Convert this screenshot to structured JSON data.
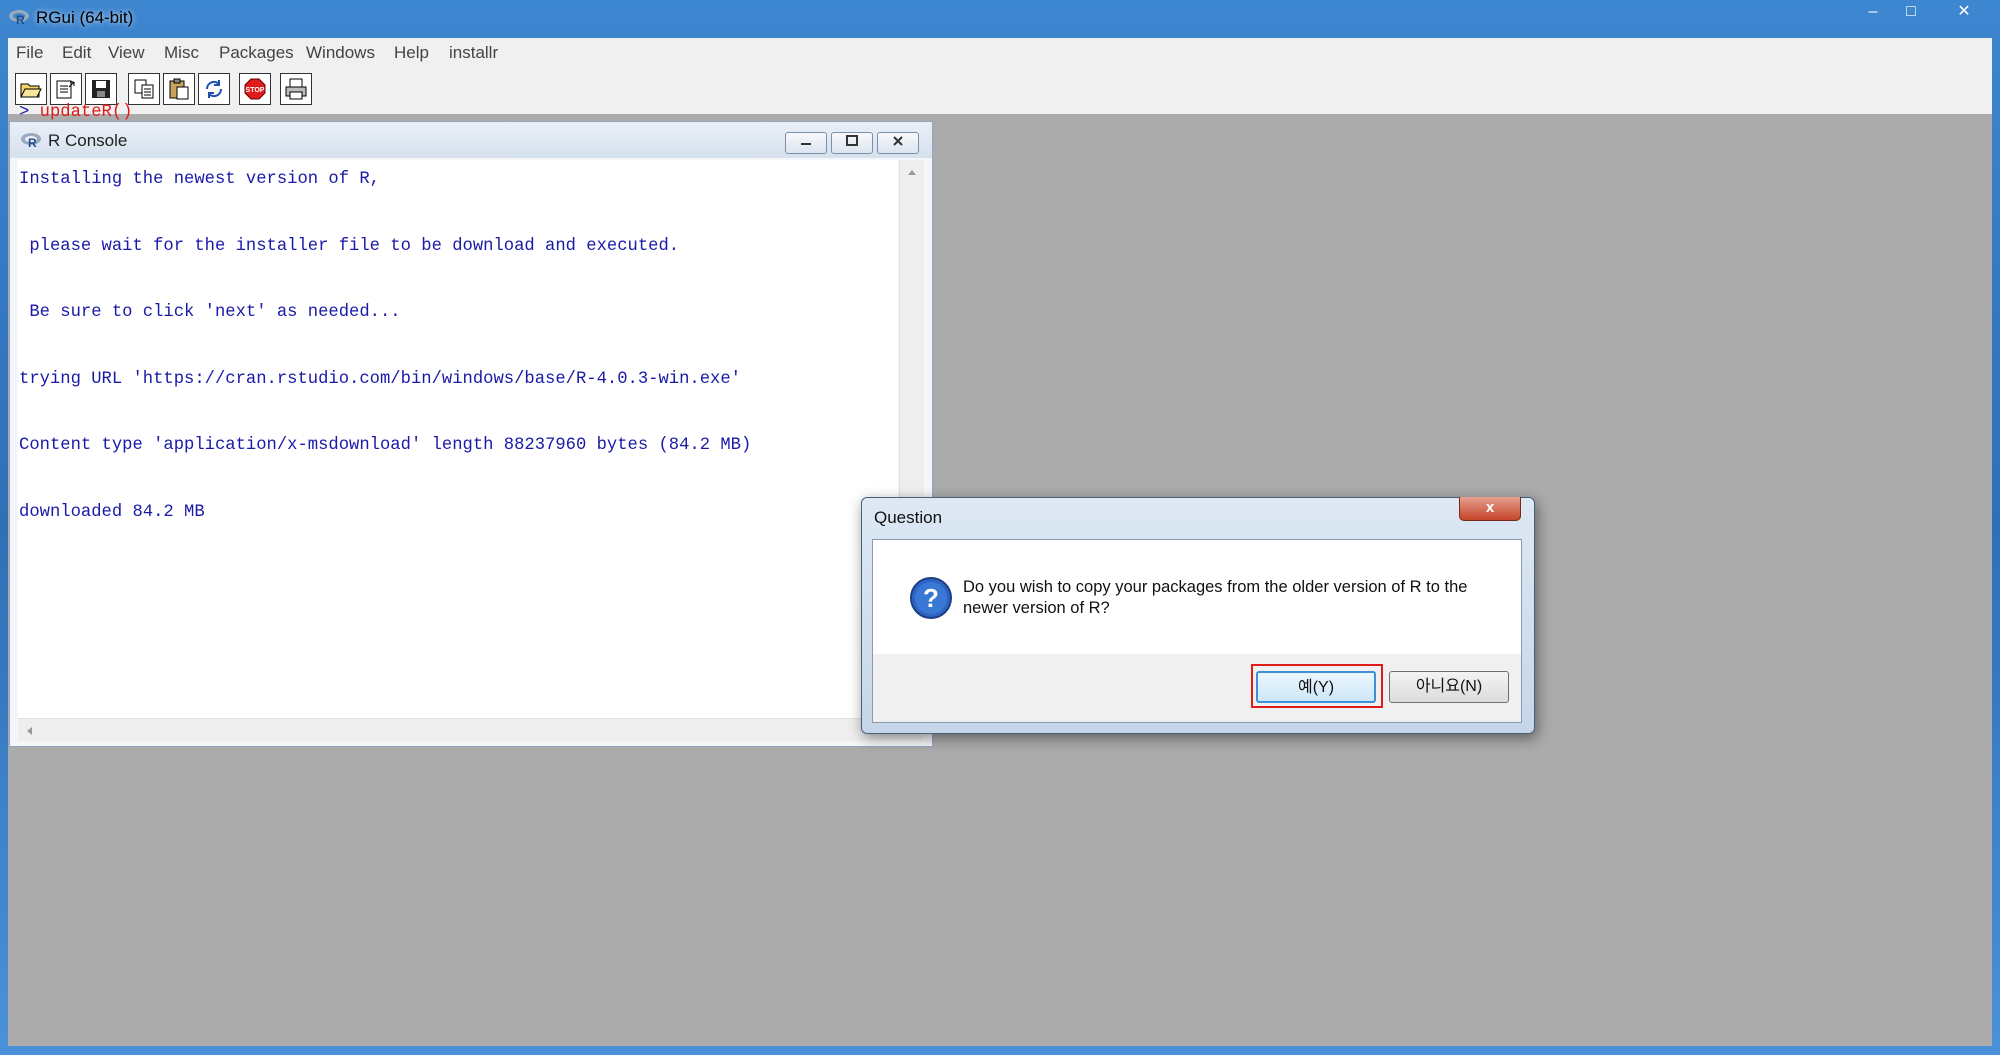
{
  "app": {
    "title": "RGui (64-bit)",
    "window_controls": {
      "minimize": "‒",
      "maximize": "□",
      "close": "✕"
    }
  },
  "menu": {
    "items": [
      {
        "label": "File"
      },
      {
        "label": "Edit"
      },
      {
        "label": "View"
      },
      {
        "label": "Misc"
      },
      {
        "label": "Packages"
      },
      {
        "label": "Windows"
      },
      {
        "label": "Help"
      },
      {
        "label": "installr"
      }
    ]
  },
  "toolbar": {
    "buttons": [
      {
        "icon": "open-script-icon"
      },
      {
        "icon": "load-workspace-icon"
      },
      {
        "icon": "save-workspace-icon"
      },
      {
        "icon": "copy-icon"
      },
      {
        "icon": "paste-icon"
      },
      {
        "icon": "copy-paste-icon"
      },
      {
        "icon": "stop-icon"
      },
      {
        "icon": "print-icon"
      }
    ]
  },
  "console": {
    "title": "R Console",
    "lines": [
      {
        "prompt": "> ",
        "command": "updateR()"
      },
      {
        "text": "Installing the newest version of R,"
      },
      {
        "text": " please wait for the installer file to be download and executed."
      },
      {
        "text": " Be sure to click 'next' as needed..."
      },
      {
        "text": "trying URL 'https://cran.rstudio.com/bin/windows/base/R-4.0.3-win.exe'"
      },
      {
        "text": "Content type 'application/x-msdownload' length 88237960 bytes (84.2 MB)"
      },
      {
        "text": "downloaded 84.2 MB"
      }
    ]
  },
  "dialog": {
    "title": "Question",
    "close_label": "x",
    "icon": "question-icon",
    "message": "Do you wish to copy your packages from the older version of R to the newer version of R?",
    "yes_label": "예(Y)",
    "no_label": "아니요(N)"
  },
  "colors": {
    "accent": "#3c8fd8",
    "console_text": "#1a1aa8",
    "command_text": "#e01b1b",
    "highlight_box": "#e01b1b"
  }
}
